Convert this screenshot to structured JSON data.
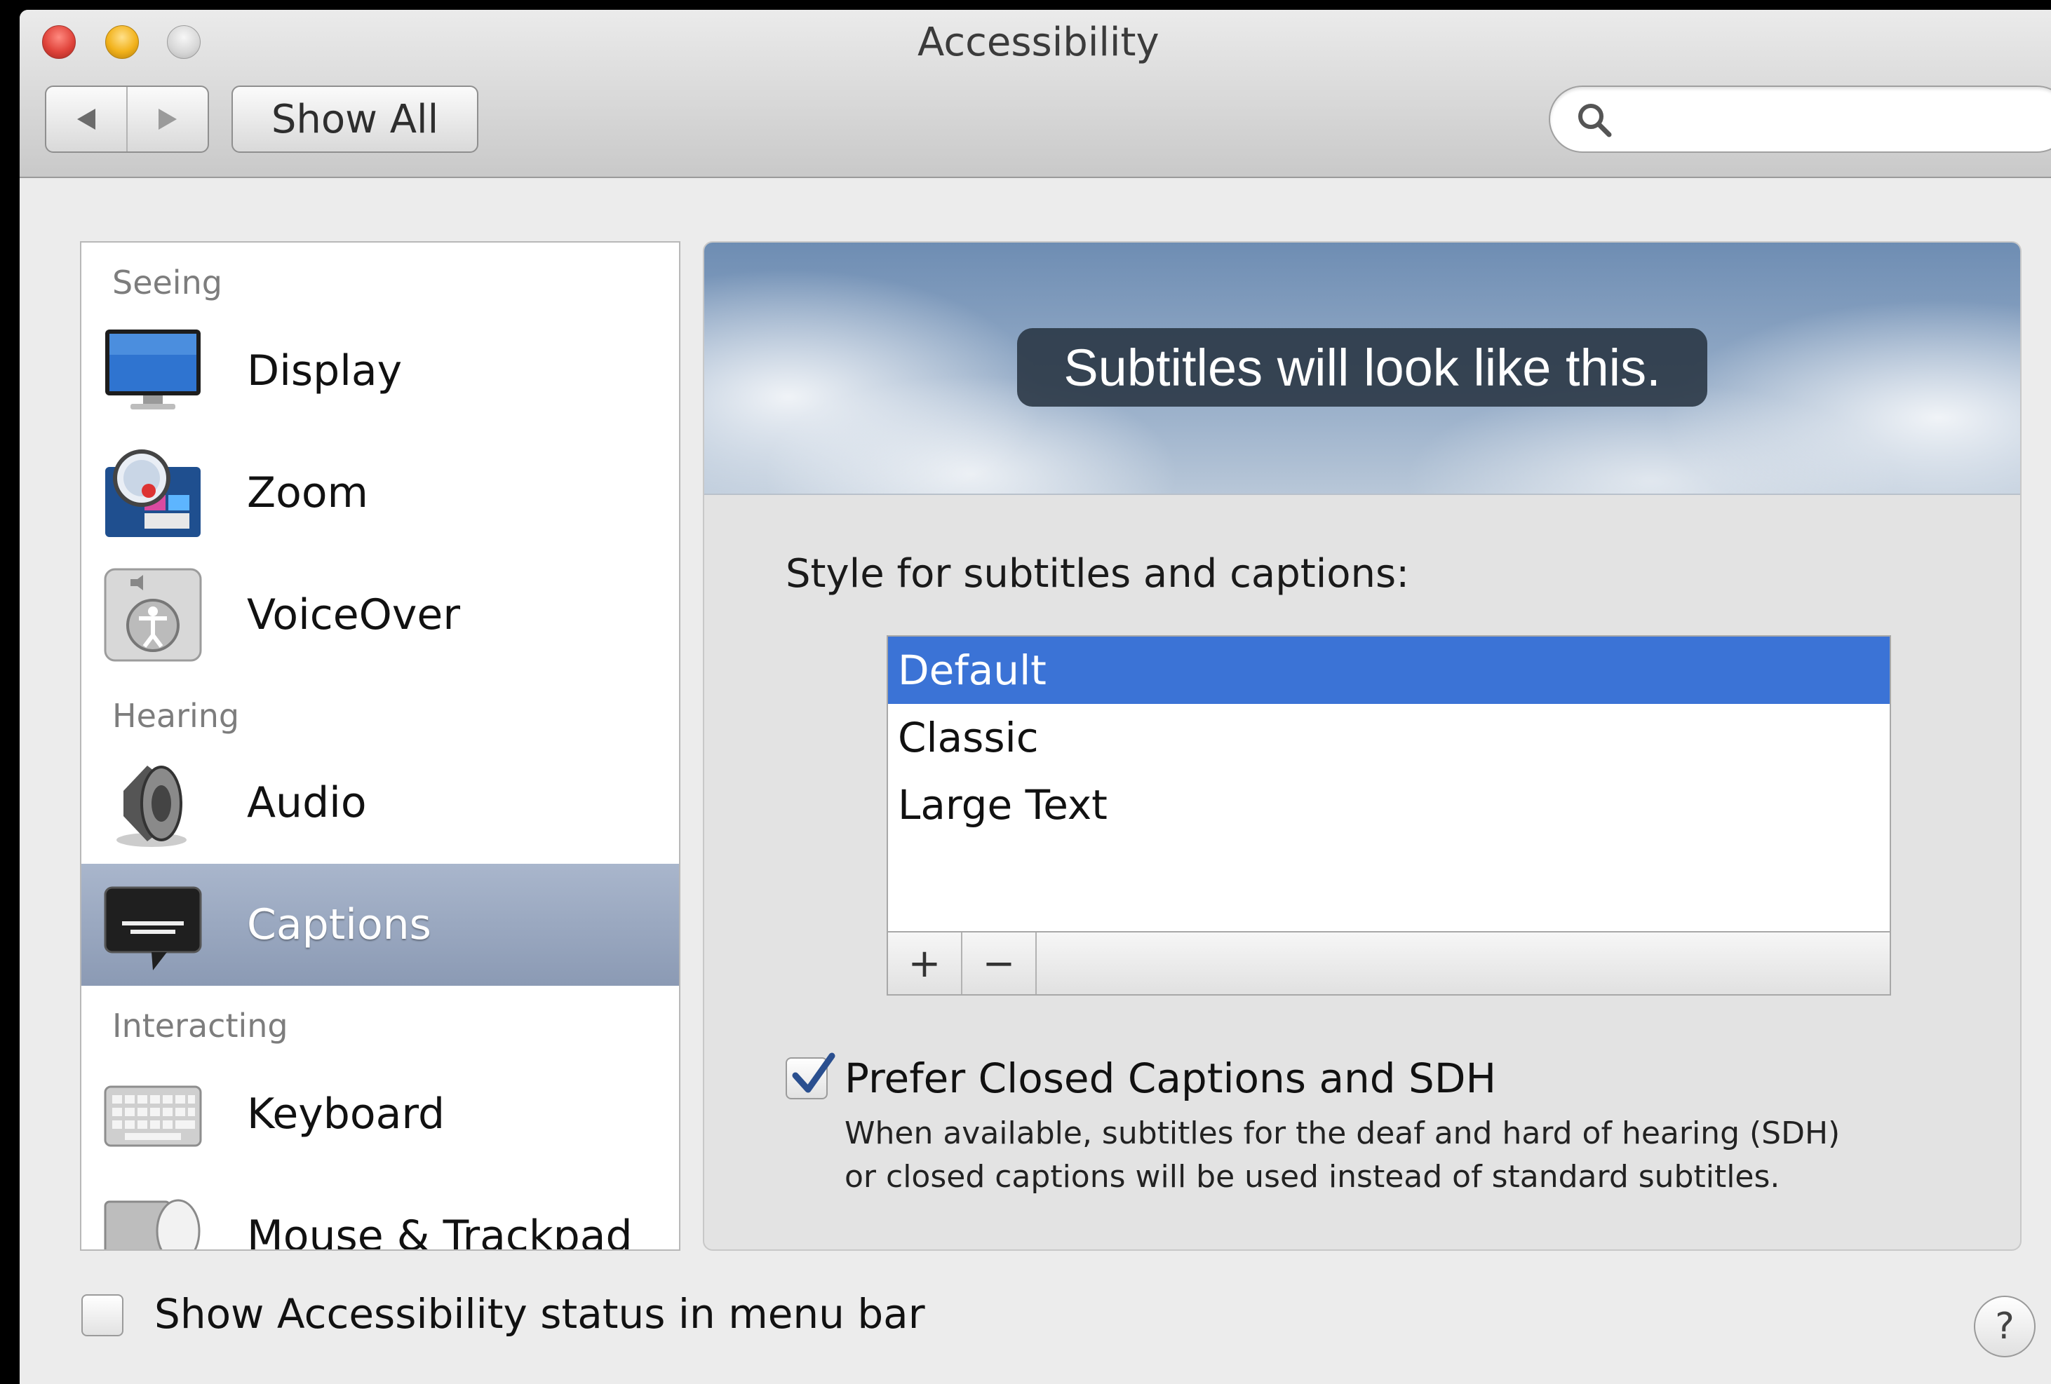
{
  "window": {
    "title": "Accessibility"
  },
  "toolbar": {
    "back_icon": "back-arrow-icon",
    "forward_icon": "forward-arrow-icon",
    "show_all_label": "Show All",
    "search_placeholder": "",
    "search_value": ""
  },
  "sidebar": {
    "sections": [
      {
        "heading": "Seeing"
      },
      {
        "heading": "Hearing"
      },
      {
        "heading": "Interacting"
      }
    ],
    "items": [
      {
        "label": "Display",
        "icon": "display-icon",
        "section": "Seeing",
        "selected": false
      },
      {
        "label": "Zoom",
        "icon": "zoom-icon",
        "section": "Seeing",
        "selected": false
      },
      {
        "label": "VoiceOver",
        "icon": "voiceover-icon",
        "section": "Seeing",
        "selected": false
      },
      {
        "label": "Audio",
        "icon": "audio-speaker-icon",
        "section": "Hearing",
        "selected": false
      },
      {
        "label": "Captions",
        "icon": "captions-icon",
        "section": "Hearing",
        "selected": true
      },
      {
        "label": "Keyboard",
        "icon": "keyboard-icon",
        "section": "Interacting",
        "selected": false
      },
      {
        "label": "Mouse & Trackpad",
        "icon": "mouse-trackpad-icon",
        "section": "Interacting",
        "selected": false
      }
    ]
  },
  "captions": {
    "preview_text": "Subtitles will look like this.",
    "style_label": "Style for subtitles and captions:",
    "styles": [
      "Default",
      "Classic",
      "Large Text"
    ],
    "selected_style": "Default",
    "add_label": "+",
    "remove_label": "−",
    "prefer_cc_label": "Prefer Closed Captions and SDH",
    "prefer_cc_checked": true,
    "prefer_cc_desc_line1": "When available, subtitles for the deaf and hard of hearing (SDH)",
    "prefer_cc_desc_line2": "or closed captions will be used instead of standard subtitles."
  },
  "footer": {
    "status_menu_label": "Show Accessibility status in menu bar",
    "status_menu_checked": false,
    "help_label": "?"
  },
  "colors": {
    "selection_blue": "#3b73d6",
    "sidebar_selected": "#98a7bf",
    "close_red": "#e0443b",
    "minimize_yellow": "#f2b21b"
  }
}
